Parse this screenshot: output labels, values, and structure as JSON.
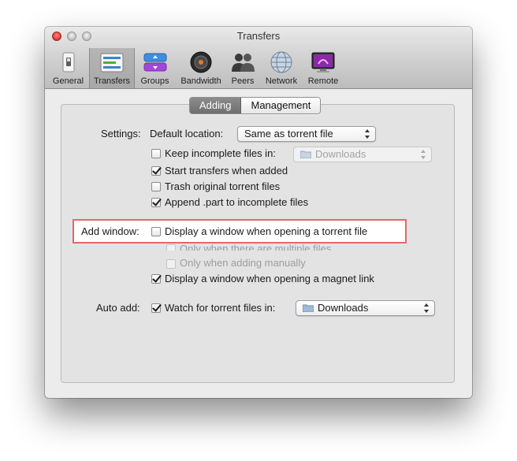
{
  "window": {
    "title": "Transfers"
  },
  "toolbar": {
    "tabs": [
      {
        "label": "General",
        "icon": "general-switch-icon"
      },
      {
        "label": "Transfers",
        "icon": "transfers-icon",
        "selected": true
      },
      {
        "label": "Groups",
        "icon": "groups-icon"
      },
      {
        "label": "Bandwidth",
        "icon": "bandwidth-icon"
      },
      {
        "label": "Peers",
        "icon": "peers-icon"
      },
      {
        "label": "Network",
        "icon": "network-icon"
      },
      {
        "label": "Remote",
        "icon": "remote-icon"
      }
    ]
  },
  "segments": {
    "adding": "Adding",
    "management": "Management",
    "selected": "Adding"
  },
  "settings": {
    "label": "Settings:",
    "default_location_label": "Default location:",
    "default_location_value": "Same as torrent file",
    "keep_incomplete_label": "Keep incomplete files in:",
    "keep_incomplete_checked": false,
    "keep_incomplete_folder": "Downloads",
    "start_transfers_label": "Start transfers when added",
    "start_transfers_checked": true,
    "trash_original_label": "Trash original torrent files",
    "trash_original_checked": false,
    "append_part_label": "Append .part to incomplete files",
    "append_part_checked": true
  },
  "add_window": {
    "label": "Add window:",
    "display_window_label": "Display a window when opening a torrent file",
    "display_window_checked": false,
    "only_multiple_label": "Only when there are multiple files",
    "only_manual_label": "Only when adding manually",
    "magnet_label": "Display a window when opening a magnet link",
    "magnet_checked": true
  },
  "auto_add": {
    "label": "Auto add:",
    "watch_label": "Watch for torrent files in:",
    "watch_checked": true,
    "folder": "Downloads"
  },
  "colors": {
    "highlight_border": "#e06a68",
    "segment_selected": "#7d7d7d"
  }
}
